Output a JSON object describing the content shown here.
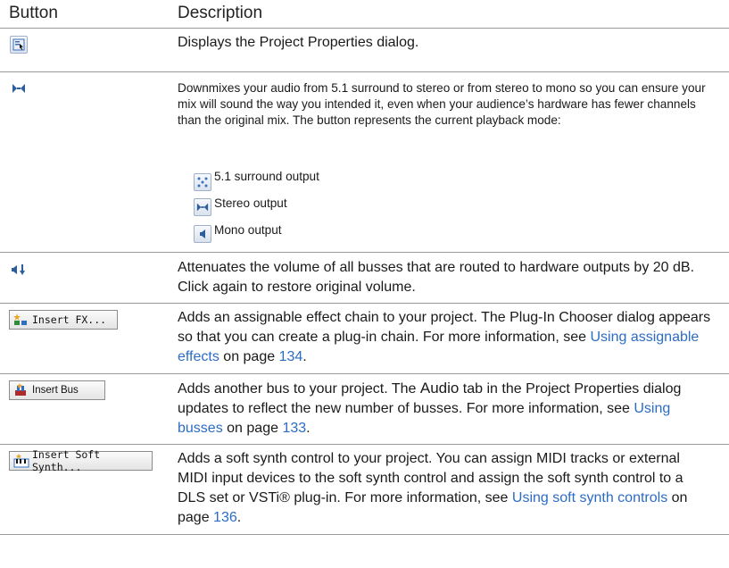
{
  "headers": {
    "button": "Button",
    "description": "Description"
  },
  "rows": {
    "project_properties": {
      "icon": "project-properties-icon",
      "description": "Displays the Project Properties dialog."
    },
    "downmix": {
      "icon": "downmix-icon",
      "description": "Downmixes your audio from 5.1 surround to stereo or from stereo to mono so you can ensure your mix will sound the way you intended it, even when your audience’s hardware has fewer channels than the original mix. The button represents the current playback mode:",
      "modes": [
        {
          "icon": "surround-output-icon",
          "label": "5.1 surround output"
        },
        {
          "icon": "stereo-output-icon",
          "label": "Stereo output"
        },
        {
          "icon": "mono-output-icon",
          "label": "Mono output"
        }
      ]
    },
    "dim": {
      "icon": "dim-output-icon",
      "description": "Attenuates the volume of all busses that are routed to hardware outputs by 20 dB. Click again to restore original volume."
    },
    "insert_fx": {
      "button_label": "Insert FX...",
      "description_before": "Adds an assignable effect chain to your project. The Plug-In Chooser dialog appears so that you can create a plug-in chain. For more information, see ",
      "link_text": "Using assignable effects",
      "mid": " on page ",
      "page": "134",
      "end": "."
    },
    "insert_bus": {
      "button_label": "Insert Bus",
      "description_before": "Adds another bus to your project. The ",
      "audio_word": "Audio",
      "description_after": " tab in the Project Properties dialog updates to reflect the new number of busses. For more information, see ",
      "link_text": "Using busses",
      "mid": " on page ",
      "page": "133",
      "end": "."
    },
    "insert_soft_synth": {
      "button_label": "Insert Soft Synth...",
      "description_before": "Adds a soft synth control to your project. You can assign MIDI tracks or external MIDI input devices to the soft synth control and assign the soft synth control to a DLS set or VSTi® plug-in. For more information, see ",
      "link_text": "Using soft synth controls",
      "mid": " on page ",
      "page": "136",
      "end": "."
    }
  }
}
